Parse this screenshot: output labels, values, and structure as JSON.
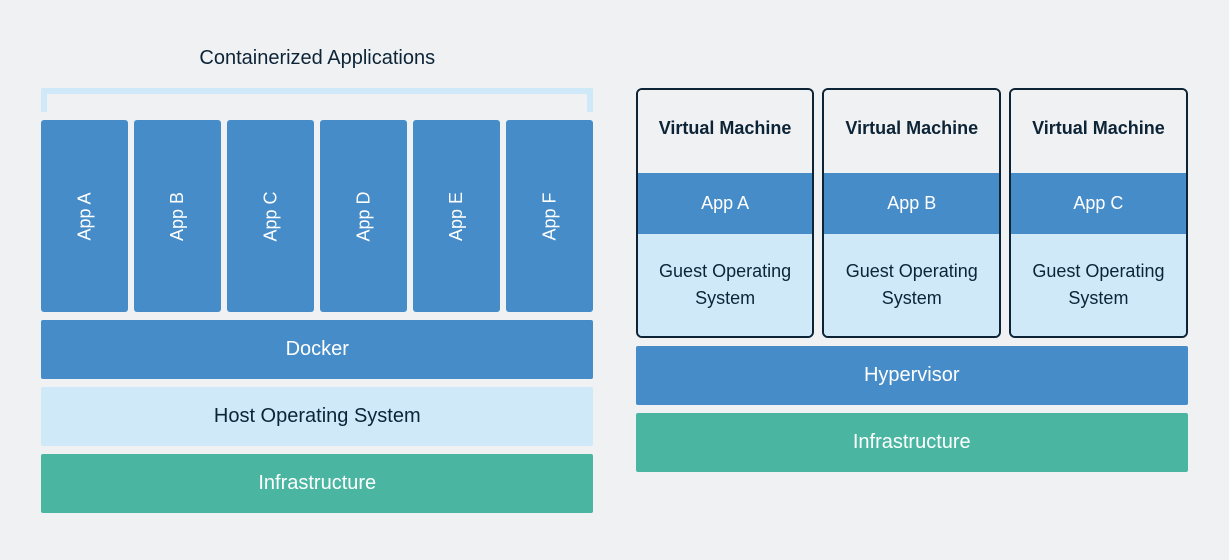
{
  "container_panel": {
    "title": "Containerized Applications",
    "apps": [
      "App A",
      "App B",
      "App C",
      "App D",
      "App E",
      "App F"
    ],
    "docker_label": "Docker",
    "host_os_label": "Host Operating System",
    "infra_label": "Infrastructure"
  },
  "vm_panel": {
    "vm_header_label": "Virtual Machine",
    "vms": [
      {
        "app": "App A",
        "os": "Guest Operating System"
      },
      {
        "app": "App B",
        "os": "Guest Operating System"
      },
      {
        "app": "App C",
        "os": "Guest Operating System"
      }
    ],
    "hypervisor_label": "Hypervisor",
    "infra_label": "Infrastructure"
  },
  "colors": {
    "blue": "#468cc8",
    "light_blue": "#cfe9f8",
    "teal": "#4ab6a1",
    "dark": "#0d2436",
    "bg": "#eff1f3"
  }
}
